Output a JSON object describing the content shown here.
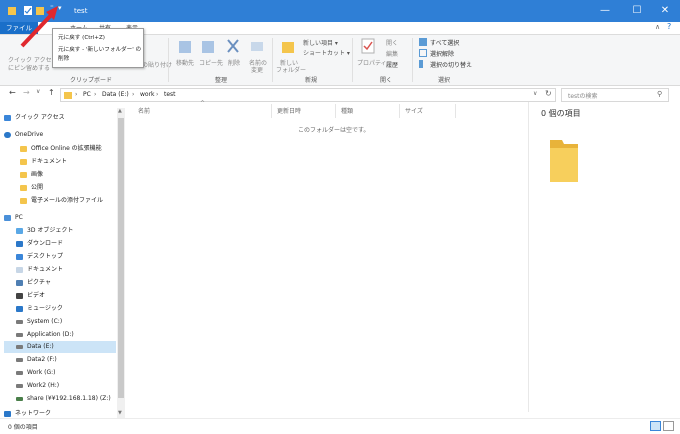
{
  "window": {
    "title": "test",
    "colors": {
      "titlebar": "#2f7fd6",
      "file_tab": "#1a6fc9",
      "selection": "#cce4f7",
      "folder": "#f4c54c"
    }
  },
  "ribbon": {
    "tabs": [
      "ファイル",
      "ホーム",
      "共有",
      "表示"
    ],
    "clipboard": {
      "pin_label_1": "クイック アクセス",
      "pin_label_2": "にピン留めする",
      "paste_shortcut": "ショートカットの貼り付け",
      "group_label": "クリップボード"
    },
    "organize": {
      "move_to": "移動先",
      "copy_to": "コピー先",
      "delete": "削除",
      "rename_1": "名前の",
      "rename_2": "変更",
      "group_label": "整理"
    },
    "new": {
      "new_folder_1": "新しい",
      "new_folder_2": "フォルダー",
      "new_item": "新しい項目",
      "shortcut": "ショートカット",
      "group_label": "新規"
    },
    "open": {
      "properties": "プロパティ",
      "open": "開く",
      "edit": "編集",
      "history": "履歴",
      "group_label": "開く"
    },
    "select": {
      "select_all": "すべて選択",
      "select_none": "選択解除",
      "invert": "選択の切り替え",
      "group_label": "選択"
    }
  },
  "tooltip": {
    "title": "元に戻す (Ctrl+Z)",
    "line1": "元に戻す - '新しいフォルダー' の",
    "line2": "削除"
  },
  "address": {
    "crumbs": [
      "PC",
      "Data (E:)",
      "work",
      "test"
    ],
    "search_placeholder": "testの検索"
  },
  "nav": {
    "quick_access": "クイック アクセス",
    "onedrive": "OneDrive",
    "onedrive_items": [
      "Office Online の拡張機能",
      "ドキュメント",
      "画像",
      "公開",
      "電子メールの添付ファイル"
    ],
    "pc": "PC",
    "pc_items": [
      "3D オブジェクト",
      "ダウンロード",
      "デスクトップ",
      "ドキュメント",
      "ピクチャ",
      "ビデオ",
      "ミュージック",
      "System (C:)",
      "Application (D:)",
      "Data (E:)",
      "Data2 (F:)",
      "Work (G:)",
      "Work2 (H:)",
      "share (¥¥192.168.1.18) (Z:)"
    ],
    "network": "ネットワーク"
  },
  "content": {
    "columns": [
      "名前",
      "更新日時",
      "種類",
      "サイズ"
    ],
    "empty_message": "このフォルダーは空です。"
  },
  "preview": {
    "count_label": "0 個の項目"
  },
  "status": {
    "count_label": "0 個の項目"
  }
}
